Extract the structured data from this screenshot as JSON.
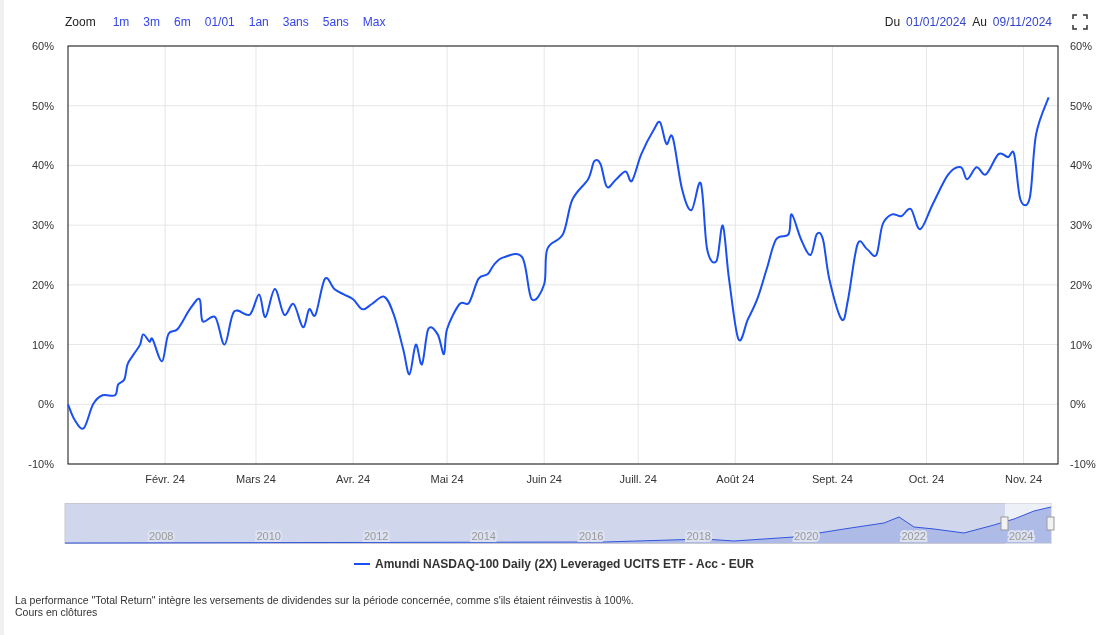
{
  "toolbar": {
    "zoom_label": "Zoom",
    "range_buttons": [
      "1m",
      "3m",
      "6m",
      "01/01",
      "1an",
      "3ans",
      "5ans",
      "Max"
    ],
    "from_label": "Du",
    "from_date": "01/01/2024",
    "to_label": "Au",
    "to_date": "09/11/2024"
  },
  "chart": {
    "chart_data": {
      "type": "line",
      "grid": true,
      "xlim": [
        "2024-01-01",
        "2024-11-12"
      ],
      "ylim": [
        -10,
        60
      ],
      "xticks": [
        {
          "value": "2024-02-01",
          "label": "Févr. 24"
        },
        {
          "value": "2024-03-01",
          "label": "Mars 24"
        },
        {
          "value": "2024-04-01",
          "label": "Avr. 24"
        },
        {
          "value": "2024-05-01",
          "label": "Mai 24"
        },
        {
          "value": "2024-06-01",
          "label": "Juin 24"
        },
        {
          "value": "2024-07-01",
          "label": "Juill. 24"
        },
        {
          "value": "2024-08-01",
          "label": "Août 24"
        },
        {
          "value": "2024-09-01",
          "label": "Sept. 24"
        },
        {
          "value": "2024-10-01",
          "label": "Oct. 24"
        },
        {
          "value": "2024-11-01",
          "label": "Nov. 24"
        }
      ],
      "yticks": [
        {
          "value": -10,
          "label": "-10%"
        },
        {
          "value": 0,
          "label": "0%"
        },
        {
          "value": 10,
          "label": "10%"
        },
        {
          "value": 20,
          "label": "20%"
        },
        {
          "value": 30,
          "label": "30%"
        },
        {
          "value": 40,
          "label": "40%"
        },
        {
          "value": 50,
          "label": "50%"
        },
        {
          "value": 60,
          "label": "60%"
        }
      ],
      "x": [
        "2024-01-01",
        "2024-01-03",
        "2024-01-06",
        "2024-01-09",
        "2024-01-12",
        "2024-01-16",
        "2024-01-17",
        "2024-01-19",
        "2024-01-20",
        "2024-01-22",
        "2024-01-24",
        "2024-01-25",
        "2024-01-27",
        "2024-01-28",
        "2024-01-31",
        "2024-02-02",
        "2024-02-05",
        "2024-02-09",
        "2024-02-12",
        "2024-02-13",
        "2024-02-17",
        "2024-02-20",
        "2024-02-23",
        "2024-02-28",
        "2024-03-02",
        "2024-03-04",
        "2024-03-07",
        "2024-03-10",
        "2024-03-13",
        "2024-03-16",
        "2024-03-18",
        "2024-03-20",
        "2024-03-23",
        "2024-03-26",
        "2024-03-29",
        "2024-04-01",
        "2024-04-04",
        "2024-04-07",
        "2024-04-11",
        "2024-04-14",
        "2024-04-17",
        "2024-04-19",
        "2024-04-21",
        "2024-04-23",
        "2024-04-25",
        "2024-04-28",
        "2024-04-30",
        "2024-05-01",
        "2024-05-05",
        "2024-05-08",
        "2024-05-11",
        "2024-05-14",
        "2024-05-16",
        "2024-05-19",
        "2024-05-25",
        "2024-05-28",
        "2024-06-01",
        "2024-06-02",
        "2024-06-07",
        "2024-06-10",
        "2024-06-15",
        "2024-06-17",
        "2024-06-19",
        "2024-06-21",
        "2024-06-24",
        "2024-06-27",
        "2024-06-29",
        "2024-07-02",
        "2024-07-06",
        "2024-07-08",
        "2024-07-10",
        "2024-07-12",
        "2024-07-15",
        "2024-07-18",
        "2024-07-21",
        "2024-07-23",
        "2024-07-26",
        "2024-07-28",
        "2024-07-30",
        "2024-08-02",
        "2024-08-05",
        "2024-08-08",
        "2024-08-11",
        "2024-08-14",
        "2024-08-18",
        "2024-08-19",
        "2024-08-22",
        "2024-08-25",
        "2024-08-27",
        "2024-08-29",
        "2024-08-31",
        "2024-09-04",
        "2024-09-06",
        "2024-09-09",
        "2024-09-12",
        "2024-09-15",
        "2024-09-17",
        "2024-09-20",
        "2024-09-23",
        "2024-09-26",
        "2024-09-29",
        "2024-10-03",
        "2024-10-08",
        "2024-10-12",
        "2024-10-14",
        "2024-10-17",
        "2024-10-20",
        "2024-10-24",
        "2024-10-27",
        "2024-10-29",
        "2024-10-31",
        "2024-11-03",
        "2024-11-05",
        "2024-11-09"
      ],
      "series": [
        {
          "name": "Amundi NASDAQ-100 Daily (2X) Leveraged UCITS ETF - Acc - EUR",
          "color": "#1a4ff0",
          "values": [
            0,
            -2.5,
            -4,
            0,
            1.5,
            1.5,
            3.3,
            4.2,
            6.7,
            8.4,
            10,
            11.7,
            10.5,
            10.9,
            7.2,
            11.7,
            12.6,
            16,
            17.6,
            13.9,
            14.6,
            10,
            15.5,
            15,
            18.4,
            14.6,
            19.3,
            15,
            16.8,
            12.9,
            15.9,
            15,
            21,
            19.3,
            18.4,
            17.6,
            15.9,
            16.8,
            18,
            15,
            9.2,
            5,
            10,
            6.7,
            12.6,
            11.7,
            8.4,
            12.6,
            16.8,
            17,
            21,
            21.8,
            23.4,
            24.6,
            24.6,
            17.6,
            20.1,
            26,
            28.5,
            34.3,
            37.7,
            40.7,
            40.2,
            36.4,
            37.7,
            39,
            37.4,
            41.9,
            46,
            47.2,
            43.6,
            44.7,
            36,
            32.5,
            37,
            26,
            24,
            29.9,
            21,
            10.9,
            14.2,
            17.6,
            22.6,
            27.6,
            28.5,
            31.8,
            27.6,
            25,
            28.5,
            27.6,
            21,
            14.2,
            17.6,
            26.8,
            26,
            25,
            30.1,
            31.8,
            31.5,
            32.7,
            29.3,
            33.5,
            38.5,
            39.7,
            37.7,
            39.7,
            38.5,
            41.9,
            41.4,
            41.9,
            34.3,
            34.6,
            45.2,
            51.4
          ]
        }
      ]
    }
  },
  "navigator": {
    "year_labels": [
      "2008",
      "2010",
      "2012",
      "2014",
      "2016",
      "2018",
      "2020",
      "2022",
      "2024"
    ]
  },
  "footnotes": [
    "La performance \"Total Return\" intègre les versements de dividendes sur la période concernée, comme s'ils étaient réinvestis à 100%.",
    "Cours en clôtures"
  ]
}
